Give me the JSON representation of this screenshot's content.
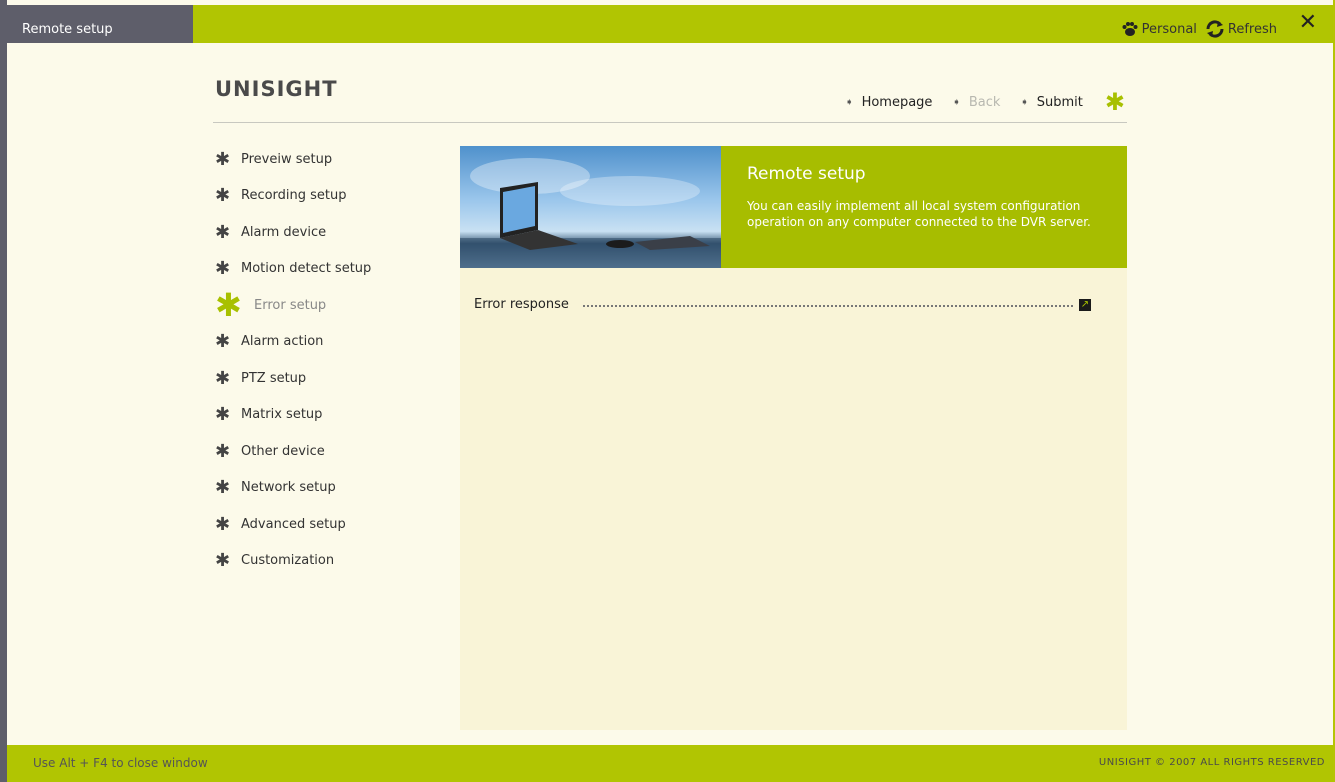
{
  "window": {
    "title": "Remote setup"
  },
  "top_actions": {
    "personal": "Personal",
    "refresh": "Refresh",
    "close": "✕"
  },
  "brand": {
    "logo": "UNISIGHT",
    "accent": "#a8c000"
  },
  "nav": {
    "homepage": "Homepage",
    "back": "Back",
    "submit": "Submit"
  },
  "sidebar": {
    "items": [
      {
        "label": "Preveiw setup"
      },
      {
        "label": "Recording setup"
      },
      {
        "label": "Alarm device"
      },
      {
        "label": "Motion detect setup"
      },
      {
        "label": "Error setup",
        "active": true
      },
      {
        "label": "Alarm action"
      },
      {
        "label": "PTZ setup"
      },
      {
        "label": "Matrix setup"
      },
      {
        "label": "Other device"
      },
      {
        "label": "Network setup"
      },
      {
        "label": "Advanced setup"
      },
      {
        "label": "Customization"
      }
    ]
  },
  "banner": {
    "title": "Remote setup",
    "description": "You can easily implement all local system configuration operation on any computer connected to the DVR server."
  },
  "content": {
    "rows": [
      {
        "label": "Error response"
      }
    ]
  },
  "footer": {
    "hint": "Use Alt + F4 to close window",
    "copyright": "UNISIGHT © 2007 ALL RIGHTS RESERVED"
  },
  "icons": {
    "personal": "paw-icon",
    "refresh": "refresh-icon",
    "nav_arrow": "arrow-right-icon",
    "star": "star-icon",
    "edit": "edit-icon"
  }
}
